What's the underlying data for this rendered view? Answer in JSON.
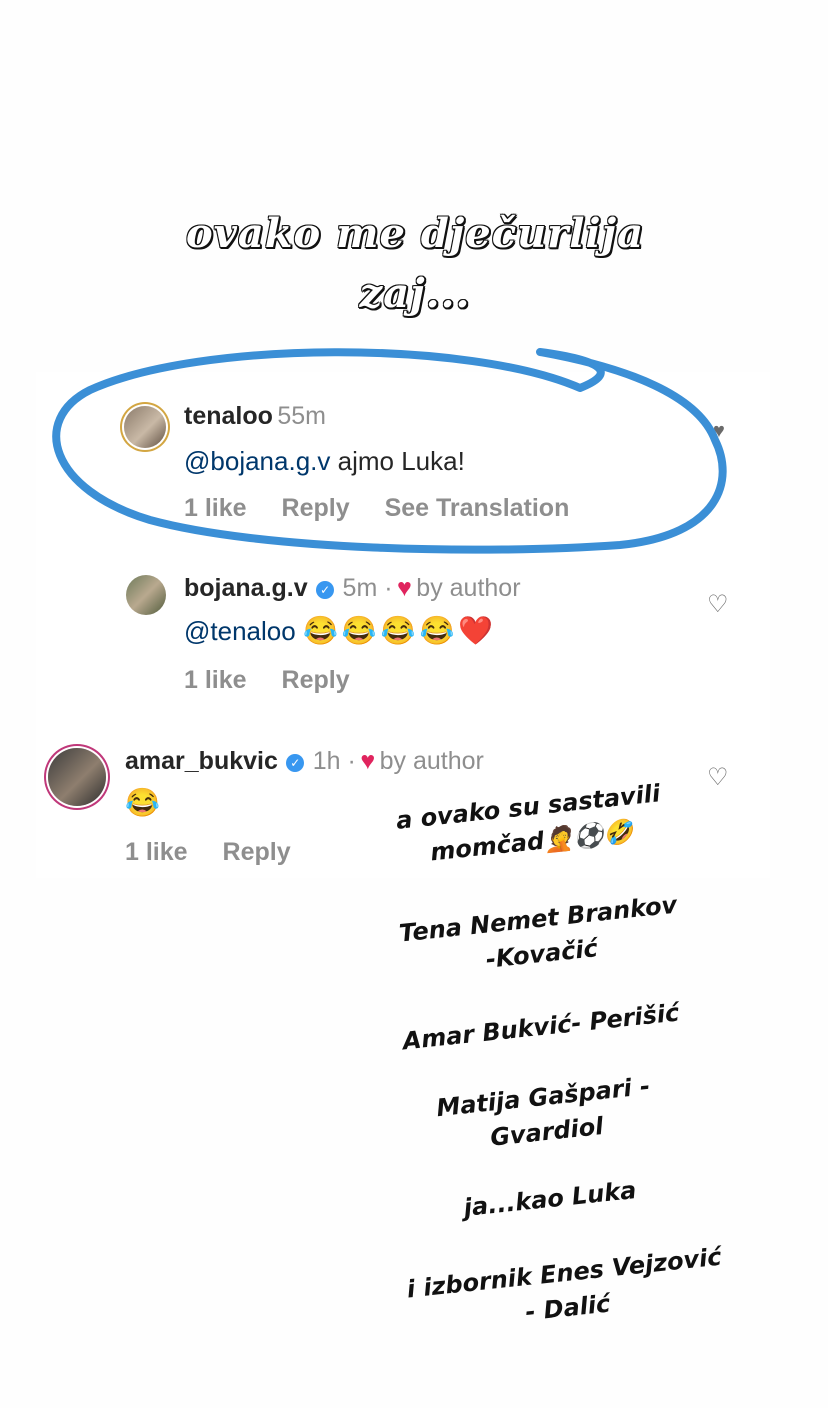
{
  "headline": {
    "line1": "ovako me dječurlija",
    "line2": "zaj..."
  },
  "comments": [
    {
      "username": "tenaloo",
      "time": "55m",
      "mention": "@bojana.g.v",
      "text": " ajmo Luka!",
      "likes": "1 like",
      "reply": "Reply",
      "translate": "See Translation"
    },
    {
      "username": "bojana.g.v",
      "time": "5m ·",
      "by_author": "by author",
      "mention": "@tenaloo",
      "emojis": "😂😂😂😂❤️",
      "likes": "1 like",
      "reply": "Reply"
    },
    {
      "username": "amar_bukvic",
      "time": "1h ·",
      "by_author": "by author",
      "emojis": "😂",
      "likes": "1 like",
      "reply": "Reply"
    }
  ],
  "stickers": {
    "s1": "a ovako su sastavili",
    "s1b": "momčad🤦⚽🤣",
    "s2": "Tena Nemet Brankov",
    "s2b": "-Kovačić",
    "s3": "Amar Bukvić- Perišić",
    "s4": "Matija Gašpari -",
    "s4b": "Gvardiol",
    "s5": "ja...kao Luka",
    "s6": "i izbornik Enes Vejzović",
    "s6b": "- Dalić"
  },
  "icons": {
    "heart": "♥",
    "heart_outline": "♡",
    "verified": "✓"
  },
  "colors": {
    "circle": "#3b8fd6",
    "mention": "#00376b",
    "heart": "#e0245e",
    "verified": "#3897f0"
  }
}
